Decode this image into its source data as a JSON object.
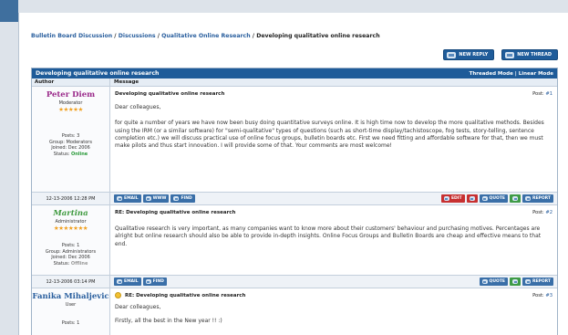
{
  "breadcrumb": {
    "items": [
      "Bulletin Board Discussion",
      "Discussions",
      "Qualitative Online Research"
    ],
    "separator": "/",
    "current": "Developing qualitative online research"
  },
  "actions": {
    "new_reply": "NEW REPLY",
    "new_thread": "NEW THREAD"
  },
  "thread": {
    "title": "Developing qualitative online research",
    "threaded_mode": "Threaded Mode",
    "mode_sep": "|",
    "linear_mode": "Linear Mode",
    "col_author": "Author",
    "col_message": "Message"
  },
  "post_label": "Post:",
  "posts": [
    {
      "author": "Peter Diem",
      "name_color": "#9a2a8a",
      "role": "Moderator",
      "stars": "★★★★★",
      "stat_posts": "Posts: 3",
      "stat_group": "Group: Moderators",
      "stat_joined": "Joined: Dec 2006",
      "status_label": "Status:",
      "status_value": "Online",
      "subject": "Developing qualitative online research",
      "post_no": "#1",
      "greeting": "Dear colleagues,",
      "body": "for quite a number of years we have now been busy doing quantitative surveys online. It is high time now to develop the more qualitative methods. Besides using the IRM (or a similar software) for \"semi-qualitative\" types of questions (such as short-time display/tachistoscope, fog tests, story-telling, sentence completion etc.) we will discuss practical use of online focus groups, bulletin boards etc. First we need fitting and affordable software for that, then we must make pilots and thus start innovation. I will provide some of that. Your comments are most welcome!",
      "date": "12-13-2006 12:28 PM",
      "btn_email": "EMAIL",
      "btn_www": "WWW",
      "btn_find": "FIND",
      "btn_edit": "EDIT",
      "btn_quote": "QUOTE",
      "btn_report": "REPORT"
    },
    {
      "author": "Martina",
      "name_color": "#3f9a3f",
      "role": "Administrator",
      "stars": "★★★★★★★",
      "stat_posts": "Posts: 1",
      "stat_group": "Group: Administrators",
      "stat_joined": "Joined: Dec 2006",
      "status_label": "Status:",
      "status_value": "Offline",
      "subject": "RE: Developing qualitative online research",
      "post_no": "#2",
      "body": "Qualitative research is very important, as many companies want to know more about their customers' behaviour and purchasing motives. Percentages are alright but online research should also be able to provide in-depth insights. Online Focus Groups and Bulletin Boards are cheap and effective means to that end.",
      "date": "12-13-2006 03:14 PM",
      "btn_email": "EMAIL",
      "btn_find": "FIND",
      "btn_quote": "QUOTE",
      "btn_report": "REPORT"
    },
    {
      "author": "Fanika Mihaljevic",
      "name_color": "#2a5f9e",
      "role": "User",
      "stat_posts": "Posts: 1",
      "subject": "RE: Developing qualitative online research",
      "post_no": "#3",
      "greeting": "Dear colleagues,",
      "body_partial": "Firstly, all the best in the New year !! :)"
    }
  ]
}
